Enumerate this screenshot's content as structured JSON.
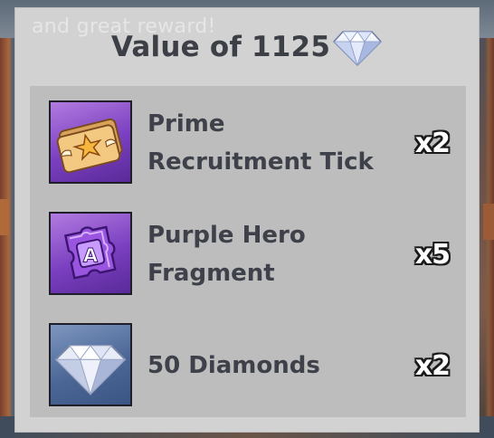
{
  "background": {
    "ghost_text": "and great reward!"
  },
  "popup": {
    "title": "Value of 1125",
    "title_icon": "diamond-icon"
  },
  "items": [
    {
      "name": "Prime Recruitment Tick",
      "quantity": "x2",
      "icon": "recruitment-ticket-icon",
      "frame_color": "#7a3fc0"
    },
    {
      "name": "Purple Hero Fragment",
      "quantity": "x5",
      "icon": "hero-fragment-icon",
      "frame_color": "#7a3fc0"
    },
    {
      "name": "50 Diamonds",
      "quantity": "x2",
      "icon": "diamond-icon",
      "frame_color": "#4c6796"
    }
  ]
}
